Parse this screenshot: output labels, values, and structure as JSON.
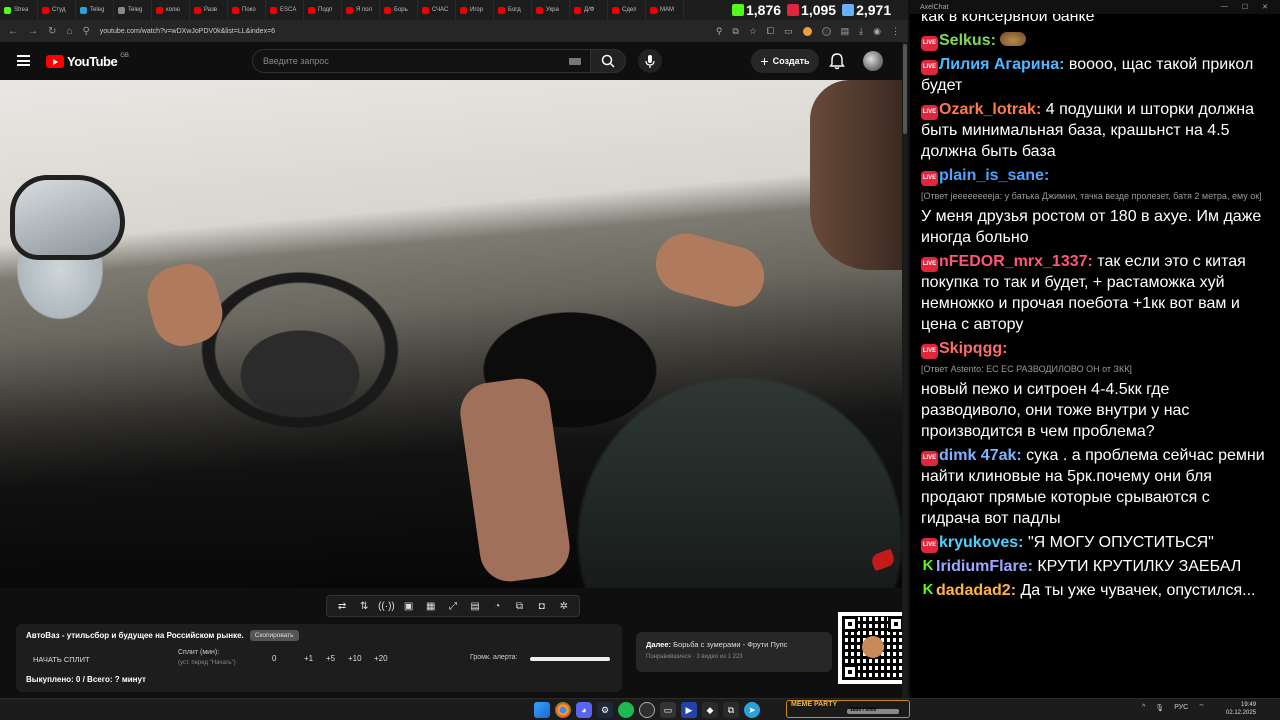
{
  "browser": {
    "tabs": [
      {
        "label": "Strea",
        "kind": "kick"
      },
      {
        "label": "Студ",
        "kind": "yt"
      },
      {
        "label": "Teleg",
        "kind": "tg"
      },
      {
        "label": "Teleg",
        "kind": "gh"
      },
      {
        "label": "колю",
        "kind": "yt"
      },
      {
        "label": "Разв",
        "kind": "yt"
      },
      {
        "label": "Поко",
        "kind": "yt"
      },
      {
        "label": "ESCA",
        "kind": "yt"
      },
      {
        "label": "Подп",
        "kind": "yt"
      },
      {
        "label": "Я пол",
        "kind": "yt"
      },
      {
        "label": "Борь",
        "kind": "yt"
      },
      {
        "label": "СЧАС",
        "kind": "yt"
      },
      {
        "label": "Игор",
        "kind": "yt"
      },
      {
        "label": "Богд",
        "kind": "yt"
      },
      {
        "label": "Укра",
        "kind": "yt"
      },
      {
        "label": "Д/Ф",
        "kind": "yt"
      },
      {
        "label": "Сдел",
        "kind": "yt"
      },
      {
        "label": "МАМ",
        "kind": "yt"
      }
    ],
    "counters": [
      {
        "value": "1,876",
        "icon": "kick-icon",
        "color": "#53fc18"
      },
      {
        "value": "1,095",
        "icon": "live-icon",
        "color": "#e0263d"
      },
      {
        "value": "2,971",
        "icon": "viewers-icon",
        "color": "#6ab0ff"
      }
    ],
    "url": "youtube.com/watch?v=wDXwJoPDV0k&list=LL&index=6"
  },
  "youtube": {
    "logo_text": "YouTube",
    "country": "GB",
    "search_placeholder": "Введите запрос",
    "create_label": "Создать"
  },
  "panel": {
    "title": "АвтоВаз - утильсбор и будущее на Российском рынке.",
    "copy_label": "Скопировать",
    "split_button": "НАЧАТЬ СПЛИТ",
    "split_label": "Сплит (мин):",
    "split_hint": "(уст. перед \"Начать\")",
    "split_values": [
      "0",
      "+1",
      "+5",
      "+10",
      "+20"
    ],
    "volume_label": "Громк. алерта:",
    "volume_level": 1.0,
    "bought": "Выкуплено: 0 / Всего: ? минут"
  },
  "next": {
    "prefix": "Далее:",
    "title": "Борьба с зумерами - Фрути Пупс",
    "sub": "Понравившиеся · 3 видео из 1 223"
  },
  "chat": {
    "window_title": "AxelChat",
    "messages": [
      {
        "badge": "",
        "user": "",
        "color": "#fff",
        "text": "как в консервной банке"
      },
      {
        "badge": "LIVE",
        "user": "Selkus:",
        "color": "#7ed957",
        "text": "",
        "emote": true
      },
      {
        "badge": "LIVE",
        "user": "Лилия Агарина:",
        "color": "#4db8ff",
        "text": "воооо, щас такой прикол будет"
      },
      {
        "badge": "LIVE",
        "user": "Ozark_lotrak:",
        "color": "#ff7a45",
        "text": "4 подушки и шторки должна быть минимальная база, крашьнст на 4.5 должна быть база"
      },
      {
        "badge": "LIVE",
        "user": "plain_is_sane:",
        "color": "#4da3ff",
        "reply": "[Ответ jeeeeeeeeja: у батька Джимни, тачка везде пролезет, батя 2 метра, ему ок]",
        "text": "У меня друзья ростом от 180 в ахуе. Им даже иногда больно"
      },
      {
        "badge": "LIVE",
        "user": "nFEDOR_mrx_1337:",
        "color": "#ff5577",
        "text": "так если это с китая покупка то так и будет, + растаможка хуй немножко и прочая поебота +1кк вот вам и цена с автору"
      },
      {
        "badge": "LIVE",
        "user": "Skipqgg:",
        "color": "#ff6b6b",
        "reply": "[Ответ Astento: ЕС ЕС РАЗВОДИЛОВО ОН от ЗКК]",
        "text": "новый пежо и ситроен 4-4.5кк где разводиволо, они тоже внутри у нас производится в чем проблема?"
      },
      {
        "badge": "LIVE",
        "user": "dimk 47ak:",
        "color": "#7fb3ff",
        "text": "сука . а проблема сейчас ремни найти клиновые на 5рк.почему они бля продают прямые которые срываются с гидрача вот падлы"
      },
      {
        "badge": "LIVE",
        "user": "kryukoves:",
        "color": "#4dd0ff",
        "text": "\"Я МОГУ ОПУСТИТЬСЯ\""
      },
      {
        "badge": "K",
        "user": "IridiumFlare:",
        "color": "#9fa8ff",
        "text": "КРУТИ КРУТИЛКУ ЗАЕБАЛ"
      },
      {
        "badge": "K",
        "user": "dadadad2:",
        "color": "#ffb347",
        "text": "Да ты уже чувачек, опустился..."
      }
    ]
  },
  "taskbar": {
    "widget_label": "MEME PARTY",
    "widget_count": "1850 / 5000",
    "lang": "РУС",
    "time": "19:49",
    "date": "02.12.2025"
  }
}
